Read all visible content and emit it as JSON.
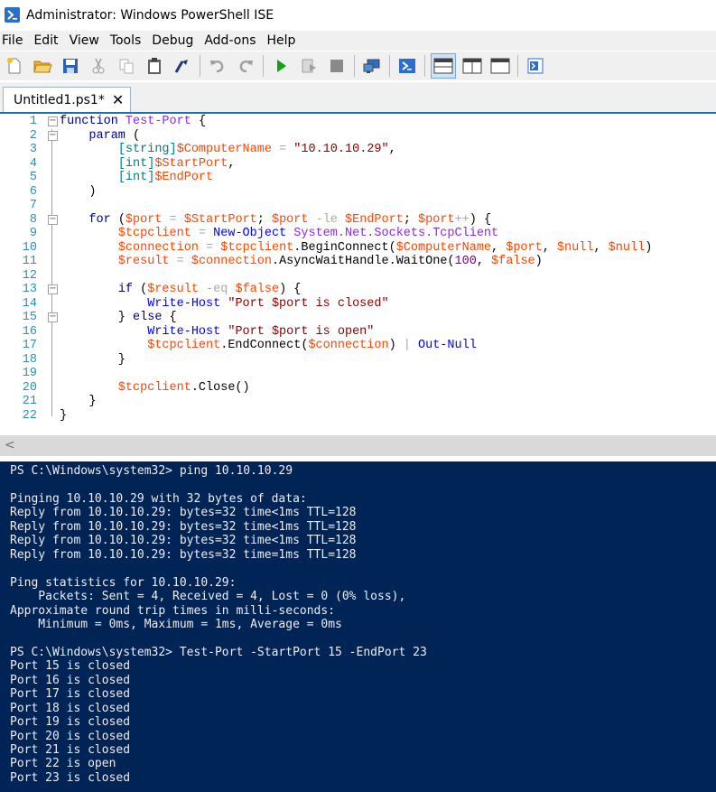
{
  "window": {
    "title": "Administrator: Windows PowerShell ISE"
  },
  "menu": [
    "File",
    "Edit",
    "View",
    "Tools",
    "Debug",
    "Add-ons",
    "Help"
  ],
  "toolbar": {
    "icons": [
      "new-file-icon",
      "open-folder-icon",
      "save-icon",
      "cut-icon",
      "copy-icon",
      "paste-icon",
      "clear-console-icon",
      "undo-icon",
      "redo-icon",
      "run-script-icon",
      "run-selection-icon",
      "stop-icon",
      "remote-powershell-icon",
      "powershell-icon",
      "show-script-pane-top-icon",
      "show-script-pane-right-icon",
      "show-script-pane-maximized-icon",
      "commands-addon-icon"
    ]
  },
  "tab": {
    "label": "Untitled1.ps1*",
    "close": "✕"
  },
  "editor": {
    "lines": [
      "function Test-Port {",
      "    param (",
      "        [string]$ComputerName = \"10.10.10.29\",",
      "        [int]$StartPort,",
      "        [int]$EndPort",
      "    )",
      "",
      "    for ($port = $StartPort; $port -le $EndPort; $port++) {",
      "        $tcpclient = New-Object System.Net.Sockets.TcpClient",
      "        $connection = $tcpclient.BeginConnect($ComputerName, $port, $null, $null)",
      "        $result = $connection.AsyncWaitHandle.WaitOne(100, $false)",
      "",
      "        if ($result -eq $false) {",
      "            Write-Host \"Port $port is closed\"",
      "        } else {",
      "            Write-Host \"Port $port is open\"",
      "            $tcpclient.EndConnect($connection) | Out-Null",
      "        }",
      "",
      "        $tcpclient.Close()",
      "    }",
      "}"
    ]
  },
  "scroll": {
    "left_arrow": "<"
  },
  "console": {
    "lines": [
      "PS C:\\Windows\\system32> ping 10.10.10.29",
      "",
      "Pinging 10.10.10.29 with 32 bytes of data:",
      "Reply from 10.10.10.29: bytes=32 time<1ms TTL=128",
      "Reply from 10.10.10.29: bytes=32 time<1ms TTL=128",
      "Reply from 10.10.10.29: bytes=32 time<1ms TTL=128",
      "Reply from 10.10.10.29: bytes=32 time=1ms TTL=128",
      "",
      "Ping statistics for 10.10.10.29:",
      "    Packets: Sent = 4, Received = 4, Lost = 0 (0% loss),",
      "Approximate round trip times in milli-seconds:",
      "    Minimum = 0ms, Maximum = 1ms, Average = 0ms",
      "",
      "PS C:\\Windows\\system32> Test-Port -StartPort 15 -EndPort 23",
      "Port 15 is closed",
      "Port 16 is closed",
      "Port 17 is closed",
      "Port 18 is closed",
      "Port 19 is closed",
      "Port 20 is closed",
      "Port 21 is closed",
      "Port 22 is open",
      "Port 23 is closed"
    ]
  },
  "colors": {
    "console_bg": "#012456",
    "console_fg": "#eeedf0",
    "line_numbers": "#2b91af"
  }
}
